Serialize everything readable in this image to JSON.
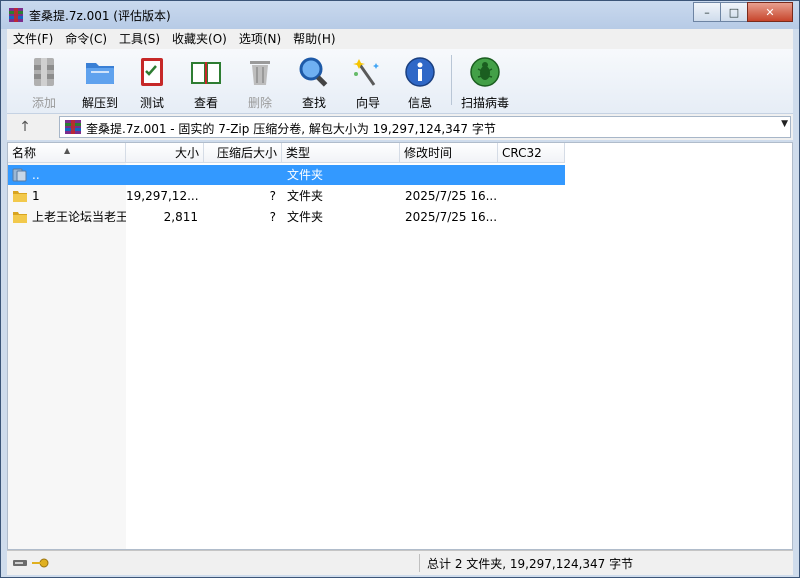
{
  "window": {
    "title": "奎桑提.7z.001 (评估版本)",
    "controls": {
      "minimize": "–",
      "maximize": "□",
      "close": "✕"
    }
  },
  "menu": [
    "文件(F)",
    "命令(C)",
    "工具(S)",
    "收藏夹(O)",
    "选项(N)",
    "帮助(H)"
  ],
  "toolbar": {
    "buttons": [
      {
        "label": "添加",
        "icon": "add-archive-icon",
        "enabled": false
      },
      {
        "label": "解压到",
        "icon": "extract-folder-icon",
        "enabled": true
      },
      {
        "label": "测试",
        "icon": "test-checklist-icon",
        "enabled": true
      },
      {
        "label": "查看",
        "icon": "view-book-icon",
        "enabled": true
      },
      {
        "label": "删除",
        "icon": "trash-icon",
        "enabled": false
      },
      {
        "label": "查找",
        "icon": "magnifier-icon",
        "enabled": true
      },
      {
        "label": "向导",
        "icon": "wizard-wand-icon",
        "enabled": true
      },
      {
        "label": "信息",
        "icon": "info-icon",
        "enabled": true
      },
      {
        "label": "扫描病毒",
        "icon": "virus-scan-icon",
        "enabled": true
      }
    ]
  },
  "address": {
    "text": "奎桑提.7z.001 - 固实的 7-Zip 压缩分卷, 解包大小为 19,297,124,347 字节"
  },
  "columns": {
    "name": "名称",
    "size": "大小",
    "packed": "压缩后大小",
    "type": "类型",
    "modified": "修改时间",
    "crc": "CRC32"
  },
  "rows": [
    {
      "name": "..",
      "size": "",
      "packed": "",
      "type": "文件夹",
      "modified": "",
      "crc": "",
      "selected": true,
      "icon": "parent-folder-icon"
    },
    {
      "name": "1",
      "size": "19,297,12...",
      "packed": "?",
      "type": "文件夹",
      "modified": "2025/7/25 16...",
      "crc": "",
      "selected": false,
      "icon": "folder-icon"
    },
    {
      "name": "上老王论坛当老王",
      "size": "2,811",
      "packed": "?",
      "type": "文件夹",
      "modified": "2025/7/25 16...",
      "crc": "",
      "selected": false,
      "icon": "folder-icon"
    }
  ],
  "status": {
    "summary": "总计 2 文件夹, 19,297,124,347 字节"
  },
  "colors": {
    "selection": "#3399ff",
    "titlebar": "#b7cbe6",
    "frame": "#cfdcec"
  }
}
